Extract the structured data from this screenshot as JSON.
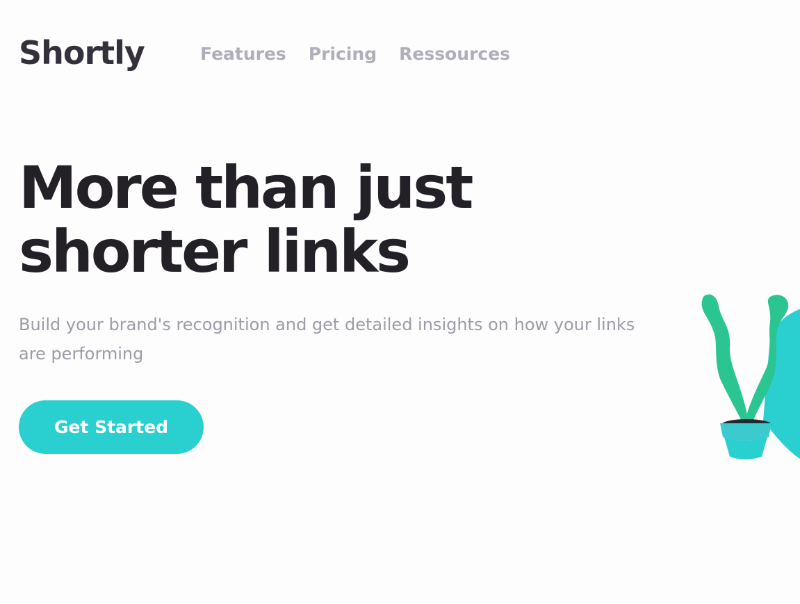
{
  "brand": {
    "name": "Shortly"
  },
  "nav": {
    "items": [
      {
        "label": "Features"
      },
      {
        "label": "Pricing"
      },
      {
        "label": "Ressources"
      }
    ]
  },
  "hero": {
    "title_line1": "More than just",
    "title_line2": "shorter links",
    "subtitle": "Build your brand's recognition and get detailed insights on how your links are performing",
    "cta_label": "Get Started"
  },
  "illustration": {
    "icon": "plant-illustration"
  },
  "colors": {
    "accent": "#2acfcf",
    "leaf": "#2bc592",
    "dark_text": "#232127",
    "muted_text": "#9e9aa8",
    "nav_text": "#b0aeb8"
  }
}
